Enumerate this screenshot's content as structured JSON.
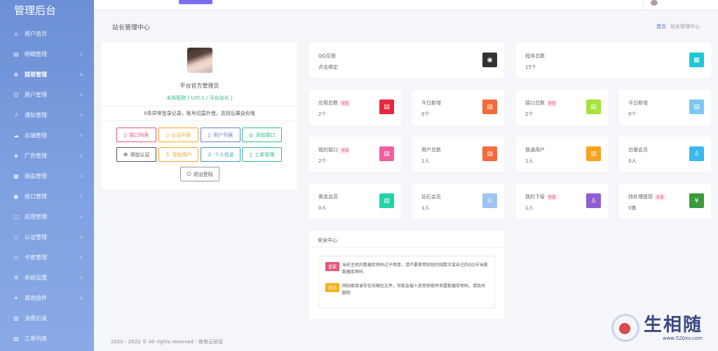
{
  "sidebar": {
    "brand": "管理后台",
    "items": [
      {
        "label": "用户首页",
        "icon": "home-icon",
        "glyph": "⌂",
        "chevron": false,
        "active": false
      },
      {
        "label": "明细管理",
        "icon": "list-icon",
        "glyph": "▤",
        "chevron": true,
        "active": false
      },
      {
        "label": "提现管理",
        "icon": "withdraw-icon",
        "glyph": "⊛",
        "chevron": true,
        "active": true
      },
      {
        "label": "用户管理",
        "icon": "user-icon",
        "glyph": "☺",
        "chevron": true,
        "active": false
      },
      {
        "label": "通知管理",
        "icon": "bell-icon",
        "glyph": "♪",
        "chevron": true,
        "active": false
      },
      {
        "label": "云端管理",
        "icon": "cloud-icon",
        "glyph": "☁",
        "chevron": true,
        "active": false
      },
      {
        "label": "广告管理",
        "icon": "ad-icon",
        "glyph": "◈",
        "chevron": true,
        "active": false
      },
      {
        "label": "商品管理",
        "icon": "product-icon",
        "glyph": "▦",
        "chevron": true,
        "active": false
      },
      {
        "label": "接口管理",
        "icon": "api-icon",
        "glyph": "▣",
        "chevron": true,
        "active": false
      },
      {
        "label": "应用管理",
        "icon": "app-icon",
        "glyph": "▢",
        "chevron": true,
        "active": false
      },
      {
        "label": "认证管理",
        "icon": "shield-icon",
        "glyph": "◇",
        "chevron": true,
        "active": false
      },
      {
        "label": "卡密管理",
        "icon": "card-icon",
        "glyph": "▭",
        "chevron": true,
        "active": false
      },
      {
        "label": "系统设置",
        "icon": "gear-icon",
        "glyph": "✲",
        "chevron": true,
        "active": false
      },
      {
        "label": "其他插件",
        "icon": "plugin-icon",
        "glyph": "✦",
        "chevron": true,
        "active": false
      },
      {
        "label": "消费记录",
        "icon": "record-icon",
        "glyph": "▧",
        "chevron": false,
        "active": false
      },
      {
        "label": "工单列表",
        "icon": "ticket-icon",
        "glyph": "▨",
        "chevron": false,
        "active": false
      }
    ]
  },
  "page": {
    "title": "站长管理中心",
    "breadcrumb_home": "首页",
    "breadcrumb_current": "站长管理中心"
  },
  "profile": {
    "name": "平台官方管理员",
    "id_line": "未知昵称 [ UID:1 / 平台站长 ]",
    "warning": "0条异常登录记录，账号切莫外借，否则后果自负哦",
    "buttons": [
      {
        "label": "接口列表",
        "color": "#e8567b",
        "glyph": "▯"
      },
      {
        "label": "认证列表",
        "color": "#f3a72a",
        "glyph": "▯"
      },
      {
        "label": "用户列表",
        "color": "#6f7bd9",
        "glyph": "▯"
      },
      {
        "label": "添加接口",
        "color": "#2bbf87",
        "glyph": "◎"
      },
      {
        "label": "添加认证",
        "color": "#555555",
        "glyph": "⊕"
      },
      {
        "label": "添加用户",
        "color": "#f3a72a",
        "glyph": "♙"
      },
      {
        "label": "个人信息",
        "color": "#3a9bd6",
        "glyph": "♙"
      },
      {
        "label": "工单管理",
        "color": "#2bbf87",
        "glyph": "▯"
      }
    ],
    "logout_label": "退出登陆"
  },
  "stats": [
    {
      "title": "QQ互联",
      "tag": "",
      "value": "点击绑定",
      "color": "#333333",
      "icon": "qq-icon",
      "glyph": "◉"
    },
    {
      "title": "程序总数",
      "tag": "",
      "value": "15个",
      "color": "#1fc8d6",
      "icon": "apps-icon",
      "glyph": "▦"
    },
    {
      "title": "应用总数",
      "tag": "管理",
      "value": "2个",
      "color": "#e8283c",
      "icon": "app-total-icon",
      "glyph": "▤"
    },
    {
      "title": "今日新增",
      "tag": "",
      "value": "0个",
      "color": "#f36b3c",
      "icon": "new-app-icon",
      "glyph": "▤"
    },
    {
      "title": "接口总数",
      "tag": "管理",
      "value": "2个",
      "color": "#a4e33d",
      "icon": "api-total-icon",
      "glyph": "▤"
    },
    {
      "title": "今日新增",
      "tag": "",
      "value": "0个",
      "color": "#7cc8f3",
      "icon": "new-api-icon",
      "glyph": "▤"
    },
    {
      "title": "我的接口",
      "tag": "管理",
      "value": "2个",
      "color": "#f060a0",
      "icon": "my-api-icon",
      "glyph": "▤"
    },
    {
      "title": "用户总数",
      "tag": "",
      "value": "1人",
      "color": "#f36b3c",
      "icon": "users-icon",
      "glyph": "▤"
    },
    {
      "title": "普通用户",
      "tag": "",
      "value": "1人",
      "color": "#f9a21f",
      "icon": "normal-user-icon",
      "glyph": "▤"
    },
    {
      "title": "白银会员",
      "tag": "",
      "value": "0人",
      "color": "#3ab8f0",
      "icon": "silver-member-icon",
      "glyph": "♙"
    },
    {
      "title": "黄金会员",
      "tag": "",
      "value": "0人",
      "color": "#22d3a6",
      "icon": "gold-member-icon",
      "glyph": "▤"
    },
    {
      "title": "钻石会员",
      "tag": "",
      "value": "1人",
      "color": "#9fc6f0",
      "icon": "diamond-member-icon",
      "glyph": "♙"
    },
    {
      "title": "我的下级",
      "tag": "管理",
      "value": "1人",
      "color": "#8e5dd4",
      "icon": "subordinate-icon",
      "glyph": "♙"
    },
    {
      "title": "待处理提现",
      "tag": "处理",
      "value": "0笔",
      "color": "#3c9b3c",
      "icon": "yen-icon",
      "glyph": "¥"
    }
  ],
  "security": {
    "title": "安全中心",
    "items": [
      {
        "label": "重要",
        "color": "#e8567b",
        "text": "当前主机的数据库密码过于简单，请不要使用较短的纯数字或自己的QQ号当做数据库密码"
      },
      {
        "label": "提示",
        "color": "#f3b21f",
        "text": "网站根目录存在压缩包文件，可能会被人恶意获取并泄露数据库密码，请及时删除"
      }
    ]
  },
  "footer": "2020 - 2022 © All rights reserved - 炼帝云验证",
  "watermark": {
    "big": "生相随",
    "small": "www.520xv.com"
  }
}
